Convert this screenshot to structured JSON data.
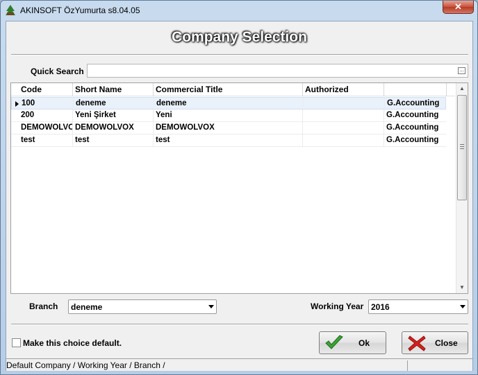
{
  "window": {
    "title": "AKINSOFT ÖzYumurta s8.04.05",
    "close_glyph": "✕"
  },
  "header": {
    "title": "Company Selection"
  },
  "quick_search": {
    "label": "Quick Search",
    "value": "",
    "button_glyph": "..."
  },
  "grid": {
    "columns": [
      "Code",
      "Short Name",
      "Commercial Title",
      "Authorized",
      ""
    ],
    "rows": [
      {
        "code": "100",
        "short_name": "deneme",
        "commercial_title": "deneme",
        "authorized": "",
        "module": "G.Accounting",
        "selected": true
      },
      {
        "code": "200",
        "short_name": "Yeni Şirket",
        "commercial_title": "Yeni",
        "authorized": "",
        "module": "G.Accounting",
        "selected": false
      },
      {
        "code": "DEMOWOLVO",
        "short_name": "DEMOWOLVOX",
        "commercial_title": "DEMOWOLVOX",
        "authorized": "",
        "module": "G.Accounting",
        "selected": false
      },
      {
        "code": "test",
        "short_name": "test",
        "commercial_title": "test",
        "authorized": "",
        "module": "G.Accounting",
        "selected": false
      }
    ]
  },
  "branch": {
    "label": "Branch",
    "value": "deneme"
  },
  "working_year": {
    "label": "Working Year",
    "value": "2016"
  },
  "default_choice": {
    "label": "Make this choice default.",
    "checked": false
  },
  "buttons": {
    "ok": "Ok",
    "close": "Close"
  },
  "status": {
    "text": "Default Company / Working Year / Branch  /"
  },
  "colors": {
    "ok_check": "#3aa335",
    "close_x": "#d8201b",
    "selected_row": "#e9f1fb"
  }
}
